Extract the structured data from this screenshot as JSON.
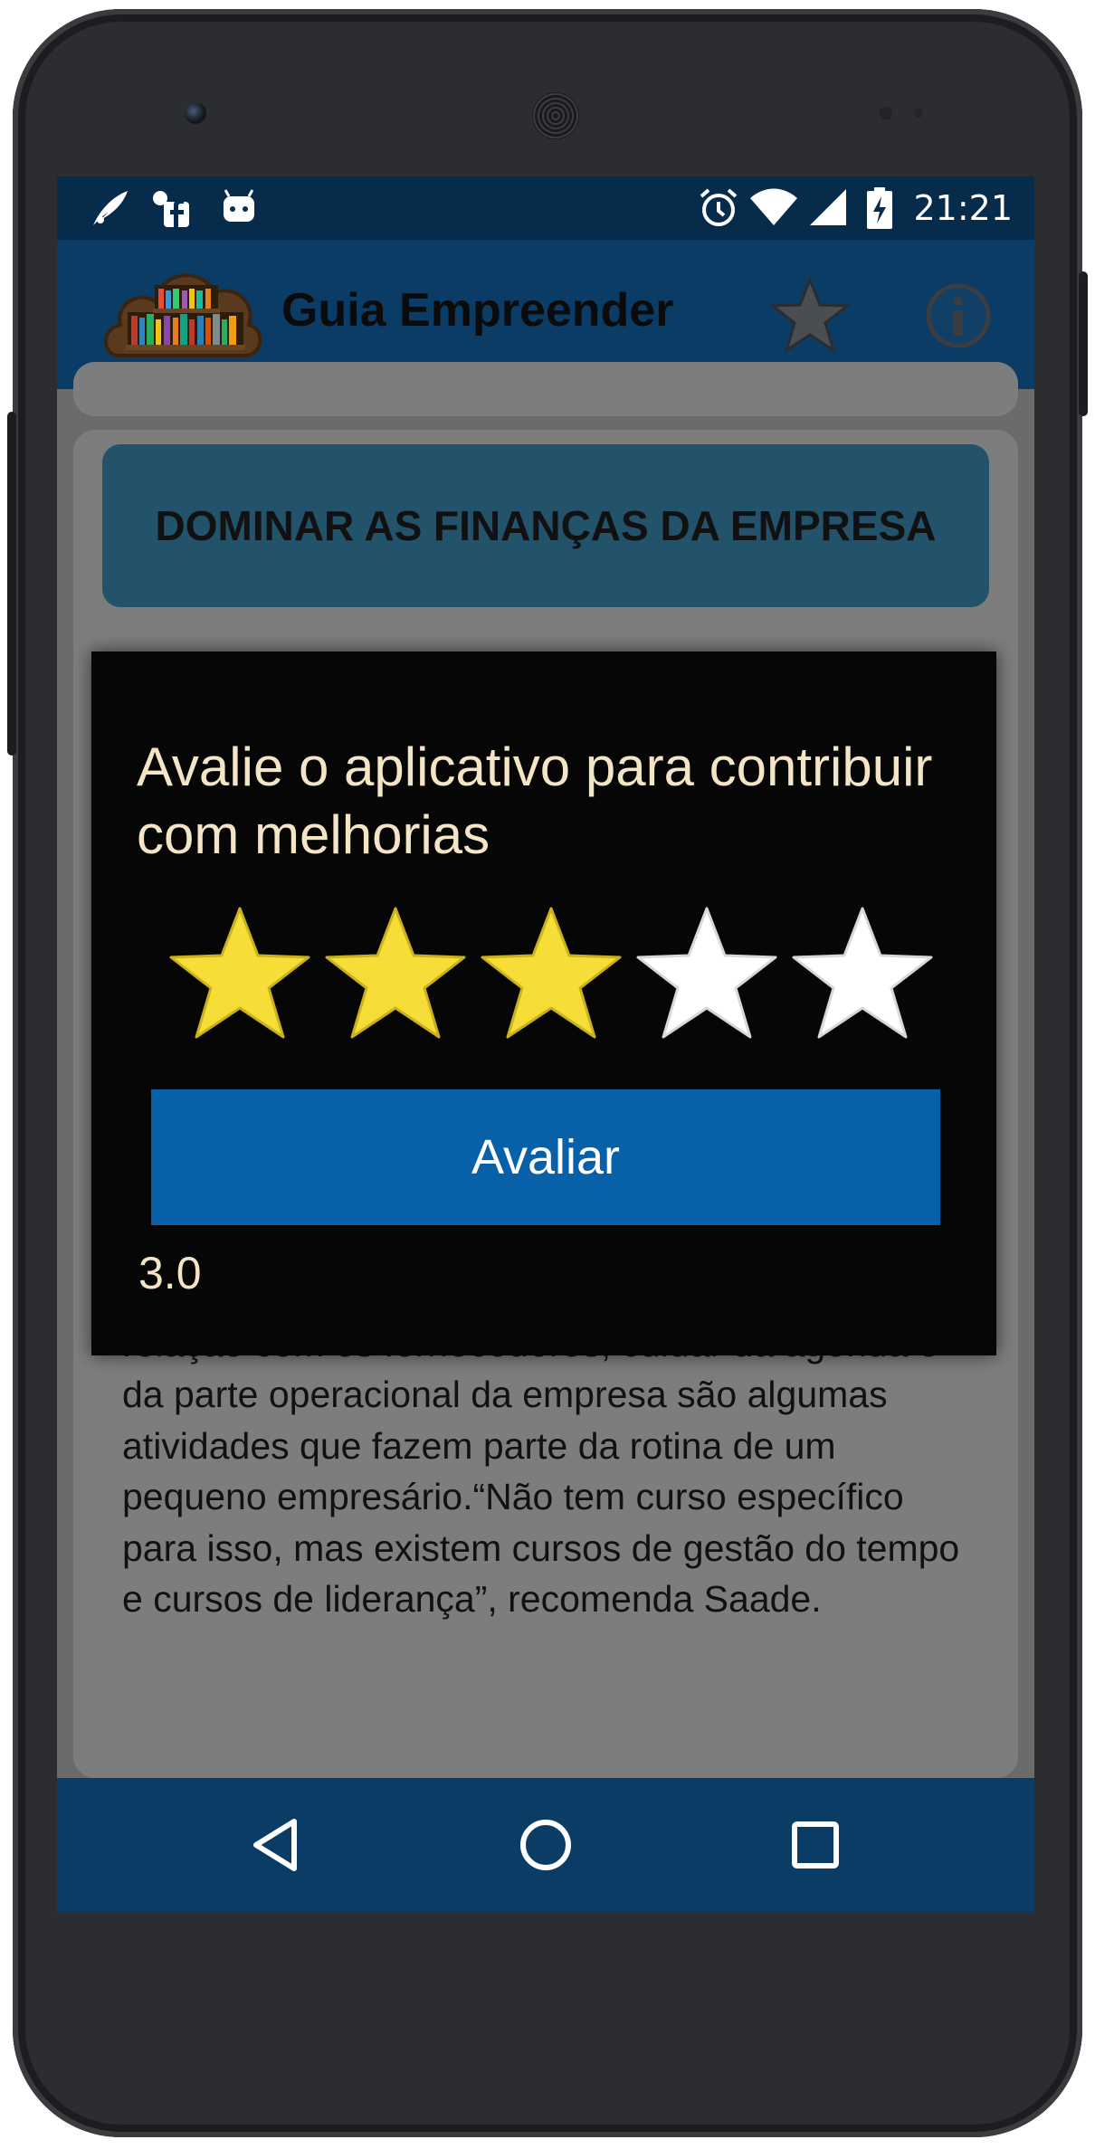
{
  "status_bar": {
    "time": "21:21",
    "left_icons": [
      "feather-notification-icon",
      "facebook-notification-icon",
      "android-notification-icon"
    ],
    "right_icons": [
      "alarm-icon",
      "wifi-icon",
      "signal-icon",
      "battery-charging-icon"
    ]
  },
  "app_bar": {
    "title": "Guia Empreender",
    "logo_icon": "bookshelf-cloud-logo",
    "actions": [
      "star-icon",
      "info-icon"
    ]
  },
  "content": {
    "topics": [
      "DOMINAR AS FINANÇAS DA EMPRESA",
      "",
      "",
      ""
    ],
    "article_text": "Liderar a equipe de funcionários, ter uma boa relação com os fornecedores, cuidar da agenda e da parte operacional da empresa são algumas atividades que fazem parte da rotina de um pequeno empresário.“Não tem curso específico para isso, mas existem cursos de gestão do tempo e cursos de liderança”, recomenda Saade."
  },
  "dialog": {
    "title": "Avalie o aplicativo para contribuir com melhorias",
    "rating": 3,
    "max_rating": 5,
    "button_label": "Avaliar",
    "rating_value_text": "3.0"
  },
  "nav_bar": {
    "buttons": [
      "back-icon",
      "home-icon",
      "recents-icon"
    ]
  },
  "colors": {
    "status_bar": "#062b4b",
    "app_bar": "#0a3c66",
    "star_filled": "#f6dd38",
    "star_empty": "#ffffff",
    "dialog_button": "#0760a8",
    "dialog_text": "#f4e5c6"
  }
}
